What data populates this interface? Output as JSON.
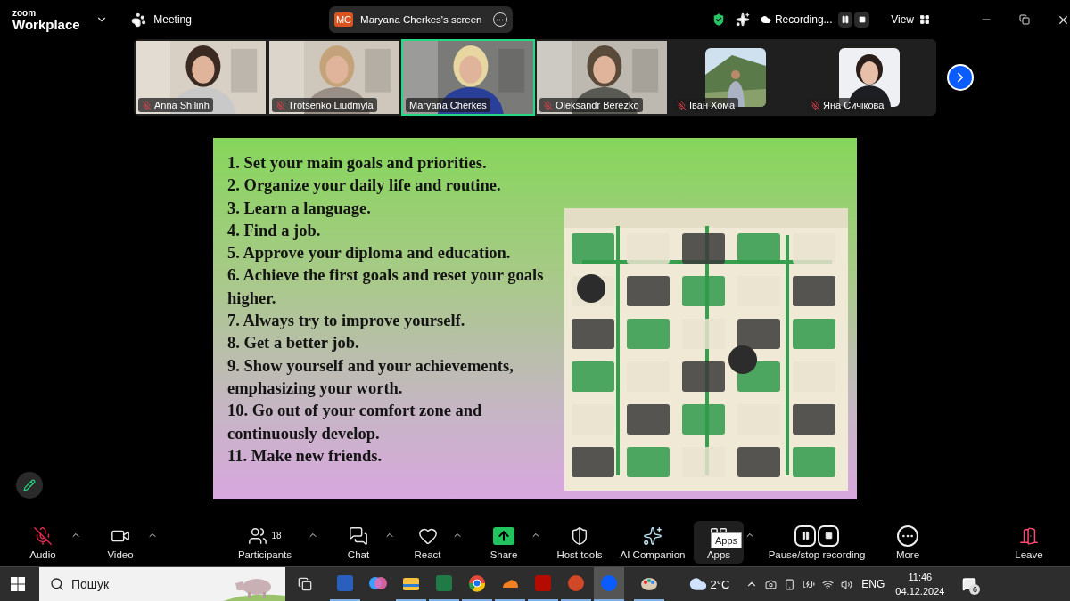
{
  "header": {
    "brand_small": "zoom",
    "brand": "Workplace",
    "meeting_label": "Meeting",
    "share": {
      "initials": "MC",
      "title": "Maryana Cherkes's screen"
    },
    "recording_label": "Recording...",
    "view_label": "View"
  },
  "participants": [
    {
      "name": "Anna Shilinh",
      "muted": true,
      "kind": "video",
      "speaking": false
    },
    {
      "name": "Trotsenko Liudmyla",
      "muted": true,
      "kind": "video",
      "speaking": false
    },
    {
      "name": "Maryana Cherkes",
      "muted": false,
      "kind": "video",
      "speaking": true
    },
    {
      "name": "Oleksandr Berezko",
      "muted": true,
      "kind": "video",
      "speaking": false
    },
    {
      "name": "Іван Хома",
      "muted": true,
      "kind": "avatar",
      "speaking": false
    },
    {
      "name": "Яна Сичікова",
      "muted": true,
      "kind": "avatar",
      "speaking": false
    }
  ],
  "slide": {
    "items": [
      "1. Set your main goals and priorities.",
      "2. Organize your daily life and routine.",
      "3. Learn a language.",
      "4. Find a job.",
      "5. Approve your diploma and education.",
      "6. Achieve the first goals and reset your goals higher.",
      "7. Always try to improve yourself.",
      "8. Get a better job.",
      "9. Show yourself and your achievements, emphasizing your worth.",
      "10. Go out of your comfort zone and continuously develop.",
      "11. Make new friends."
    ],
    "illustration": {
      "kind": "picture"
    }
  },
  "toolbar": [
    {
      "label": "Audio",
      "kind": "audio",
      "caret": true,
      "highlighted": false
    },
    {
      "label": "Video",
      "kind": "video",
      "caret": true,
      "highlighted": false
    },
    {
      "label": "Participants",
      "kind": "participants",
      "count": "18",
      "caret": true,
      "highlighted": false
    },
    {
      "label": "Chat",
      "kind": "chat",
      "caret": true,
      "highlighted": false
    },
    {
      "label": "React",
      "kind": "react",
      "caret": true,
      "highlighted": false
    },
    {
      "label": "Share",
      "kind": "share",
      "caret": true,
      "highlighted": false
    },
    {
      "label": "Host tools",
      "kind": "host",
      "caret": false,
      "highlighted": false
    },
    {
      "label": "AI Companion",
      "kind": "ai",
      "caret": false,
      "highlighted": false
    },
    {
      "label": "Apps",
      "kind": "apps",
      "caret": true,
      "highlighted": true
    },
    {
      "label": "Pause/stop recording",
      "kind": "recording",
      "caret": false,
      "highlighted": false
    },
    {
      "label": "More",
      "kind": "more",
      "caret": false,
      "highlighted": false
    },
    {
      "label": "Leave",
      "kind": "leave",
      "caret": false,
      "highlighted": false
    }
  ],
  "tooltip": "Apps",
  "taskbar": {
    "search_placeholder": "Пошук",
    "apps": [
      {
        "kind": "word",
        "active": true
      },
      {
        "kind": "copilot",
        "active": false
      },
      {
        "kind": "files",
        "active": true
      },
      {
        "kind": "excel",
        "active": true
      },
      {
        "kind": "chrome",
        "active": true
      },
      {
        "kind": "cloud",
        "active": true
      },
      {
        "kind": "acrobat",
        "active": true
      },
      {
        "kind": "powerpoint",
        "active": true
      },
      {
        "kind": "zoom",
        "active": true
      },
      {
        "kind": "paint",
        "active": true
      }
    ],
    "weather": "2°C",
    "language": "ENG",
    "time": "11:46",
    "date": "04.12.2024",
    "notifications": "6"
  }
}
